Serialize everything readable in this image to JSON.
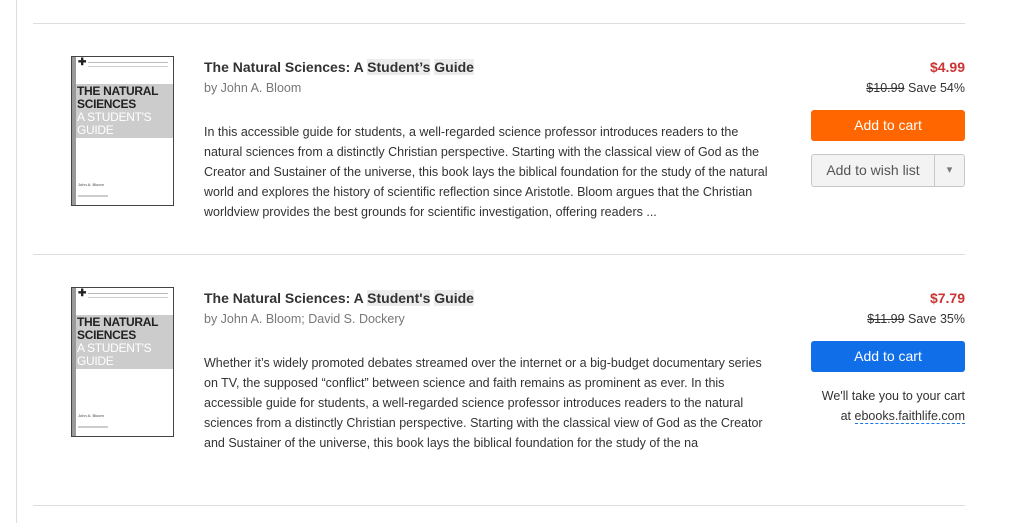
{
  "items": [
    {
      "cover": {
        "title": "THE NATURAL SCIENCES",
        "subtitle": "A STUDENT'S GUIDE",
        "author": "John A. Bloom"
      },
      "title_pre": "The Natural Sciences: A ",
      "title_hl1": "Student’s",
      "title_sp": " ",
      "title_hl2": "Guide",
      "author": "by John A. Bloom",
      "description": "In this accessible guide for students, a well-regarded science professor introduces readers to the natural sciences from a distinctly Christian perspective. Starting with the classical view of God as the Creator and Sustainer of the universe, this book lays the biblical foundation for the study of the natural world and explores the history of scientific reflection since Aristotle. Bloom argues that the Christian worldview provides the best grounds for scientific investigation, offering readers ...",
      "price": "$4.99",
      "list_price": "$10.99",
      "savings": "Save 54%",
      "add_to_cart": "Add to cart",
      "add_to_wishlist": "Add to wish list",
      "accent_color": "#ff6600"
    },
    {
      "cover": {
        "title": "THE NATURAL SCIENCES",
        "subtitle": "A STUDENT'S GUIDE",
        "author": "John A. Bloom"
      },
      "title_pre": "The Natural Sciences: A ",
      "title_hl1": "Student's",
      "title_sp": " ",
      "title_hl2": "Guide",
      "author": "by John A. Bloom; David S. Dockery",
      "description": "Whether it’s widely promoted debates streamed over the internet or a big-budget documentary series on TV, the supposed “conflict” between science and faith remains as prominent as ever. In this accessible guide for students, a well-regarded science professor introduces readers to the natural sciences from a distinctly Christian perspective. Starting with the classical view of God as the Creator and Sustainer of the universe, this book lays the biblical foundation for the study of the na",
      "price": "$7.79",
      "list_price": "$11.99",
      "savings": "Save 35%",
      "add_to_cart": "Add to cart",
      "note_line1": "We'll take you to your cart",
      "note_at": "at ",
      "note_link": "ebooks.faithlife.com",
      "accent_color": "#0f6ee8"
    }
  ],
  "colors": {
    "price": "#cc3333",
    "divider": "#dddddd"
  }
}
